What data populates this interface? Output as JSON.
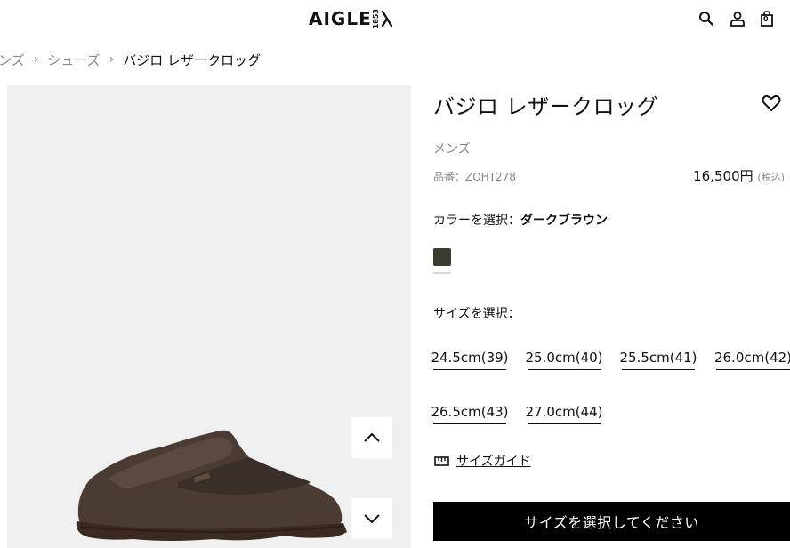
{
  "header": {
    "logo_text": "AIGLE",
    "logo_year": "1853",
    "cart_count": "0",
    "icons": [
      "search-icon",
      "account-icon",
      "cart-icon"
    ]
  },
  "breadcrumb": {
    "items": [
      "ンズ",
      "シューズ"
    ],
    "current": "バジロ レザークロッグ"
  },
  "gallery": {
    "icons": [
      "chevron-up-icon",
      "chevron-down-icon"
    ],
    "background_color": "#f0f0f0"
  },
  "product": {
    "title": "バジロ レザークロッグ",
    "gender": "メンズ",
    "sku": "品番：ZOHT278",
    "price": "16,500円",
    "tax": "(税込)"
  },
  "color": {
    "label": "カラーを選択：",
    "value": "ダークブラウン",
    "swatch_hex": "#3b3b30"
  },
  "sizes": {
    "label": "サイズを選択：",
    "options": [
      "24.5cm(39)",
      "25.0cm(40)",
      "25.5cm(41)",
      "26.0cm(42)",
      "26.5cm(43)",
      "27.0cm(44)"
    ]
  },
  "size_guide": {
    "label": "サイズガイド",
    "icon": "ruler-icon"
  },
  "cta": {
    "label": "サイズを選択してください"
  }
}
